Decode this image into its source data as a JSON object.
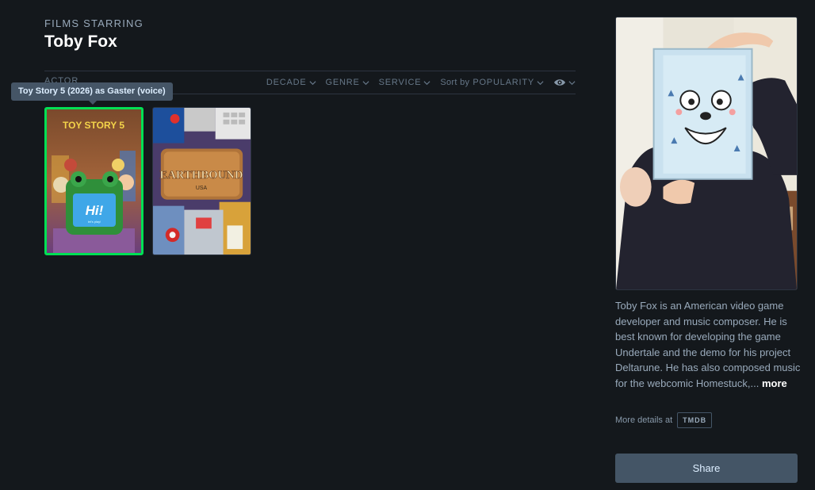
{
  "header": {
    "films_label": "FILMS STARRING",
    "person_name": "Toby Fox"
  },
  "filter_bar": {
    "tab_label": "ACTOR",
    "filters": [
      {
        "label": "DECADE",
        "icon": "chevron-down-icon"
      },
      {
        "label": "GENRE",
        "icon": "chevron-down-icon"
      },
      {
        "label": "SERVICE",
        "icon": "chevron-down-icon"
      }
    ],
    "sort_label": "Sort by",
    "sort_value": "POPULARITY",
    "eye_icon": "eye-icon"
  },
  "tooltip": "Toy Story 5 (2026) as Gaster (voice)",
  "films": [
    {
      "poster_title": "TOY STORY 5",
      "poster_tagline": "Hi!",
      "poster_subtag": "let's play!",
      "selected": true
    },
    {
      "poster_title": "EARTHBOUND",
      "poster_subtitle": "USA",
      "selected": false
    }
  ],
  "bio": {
    "text": "Toby Fox is an American video game developer and music composer. He is best known for developing the game Undertale and the demo for his project Deltarune. He has also composed music for the webcomic Homestuck,...",
    "more_label": "more",
    "details_label": "More details at",
    "tmdb_label": "TMDB"
  },
  "share_label": "Share",
  "colors": {
    "background": "#14181c",
    "selected_border": "#00e054",
    "button": "#445566"
  }
}
